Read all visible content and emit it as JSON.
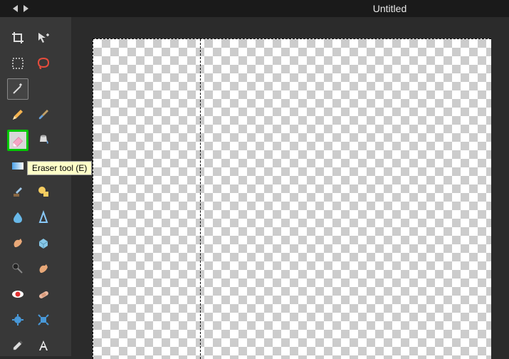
{
  "window": {
    "title": "Untitled"
  },
  "tooltip": {
    "eraser": "Eraser tool (E)"
  },
  "tools": {
    "crop": "crop",
    "move": "move",
    "marquee": "marquee",
    "lasso": "lasso",
    "wand": "wand",
    "pencil": "pencil",
    "brush": "brush",
    "eraser": "eraser",
    "bucket": "bucket",
    "gradient": "gradient",
    "clone": "clone",
    "replace": "replace",
    "sponge": "sponge",
    "blur": "blur",
    "sharpen": "sharpen",
    "smudge": "smudge",
    "dodge": "dodge",
    "burn": "burn",
    "redeye": "redeye",
    "heal": "heal",
    "bloat": "bloat",
    "pinch": "pinch",
    "eyedropper": "eyedropper",
    "type": "type"
  }
}
